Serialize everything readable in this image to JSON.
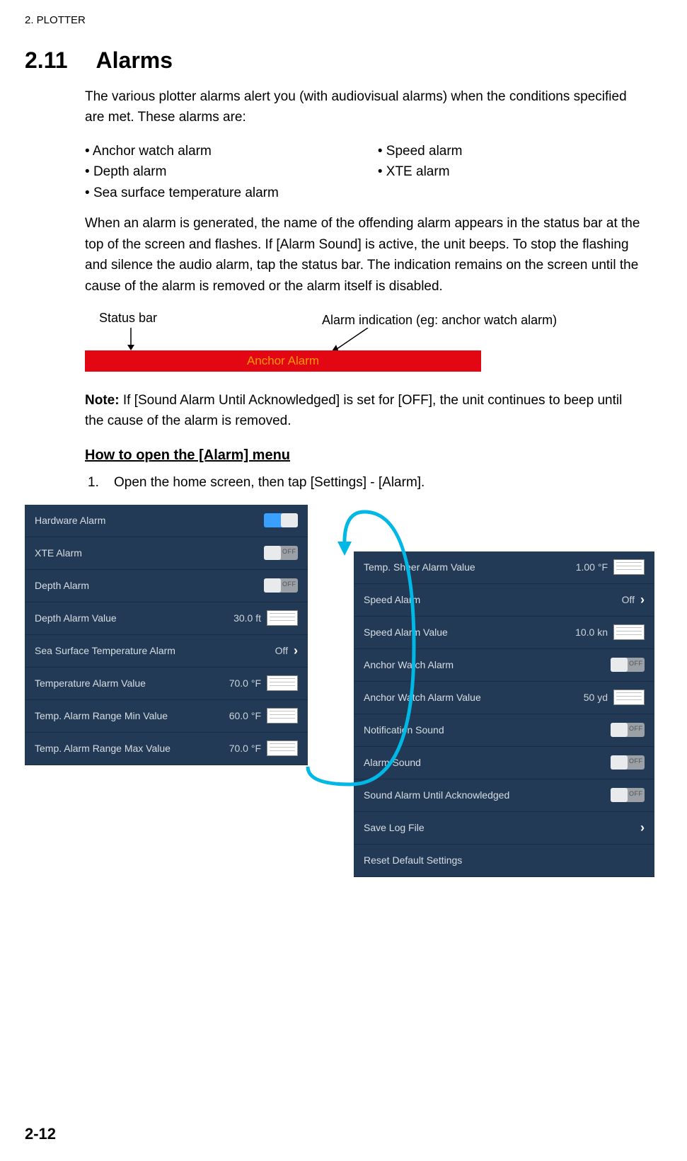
{
  "header": "2.  PLOTTER",
  "section": {
    "num": "2.11",
    "title": "Alarms"
  },
  "intro": "The various plotter alarms alert you (with audiovisual alarms) when the conditions specified are met. These alarms are:",
  "bullets_left": [
    "Anchor watch alarm",
    "Depth alarm",
    "Sea surface temperature alarm"
  ],
  "bullets_right": [
    "Speed alarm",
    "XTE alarm"
  ],
  "para2": "When an alarm is generated, the name of the offending alarm appears in the status bar at the top of the screen and flashes. If [Alarm Sound] is active, the unit beeps. To stop the flashing and silence the audio alarm, tap the status bar. The indication remains on the screen until the cause of the alarm is removed or the alarm itself is disabled.",
  "diag": {
    "status_bar_label": "Status bar",
    "alarm_indication_label": "Alarm indication (eg: anchor watch alarm)",
    "anchor_alarm_text": "Anchor Alarm"
  },
  "note_bold": "Note:",
  "note_text": " If [Sound Alarm Until Acknowledged] is set for [OFF], the unit continues to beep until the cause of the alarm is removed.",
  "subhead": "How to open the [Alarm] menu",
  "step1_num": "1.",
  "step1_text": "Open the home screen, then tap [Settings] - [Alarm].",
  "panel_a": [
    {
      "label": "Hardware Alarm",
      "type": "toggle",
      "state": "on",
      "txt": "ON"
    },
    {
      "label": "XTE Alarm",
      "type": "toggle",
      "state": "off",
      "txt": "OFF"
    },
    {
      "label": "Depth Alarm",
      "type": "toggle",
      "state": "off",
      "txt": "OFF"
    },
    {
      "label": "Depth Alarm Value",
      "type": "keypad",
      "val": "30.0 ft"
    },
    {
      "label": "Sea Surface Temperature Alarm",
      "type": "chev",
      "val": "Off"
    },
    {
      "label": "Temperature Alarm Value",
      "type": "keypad",
      "val": "70.0 °F"
    },
    {
      "label": "Temp. Alarm Range Min Value",
      "type": "keypad",
      "val": "60.0 °F"
    },
    {
      "label": "Temp. Alarm Range Max Value",
      "type": "keypad",
      "val": "70.0 °F"
    }
  ],
  "panel_b": [
    {
      "label": "Temp. Sheer Alarm Value",
      "type": "keypad",
      "val": "1.00 °F"
    },
    {
      "label": "Speed Alarm",
      "type": "chev",
      "val": "Off"
    },
    {
      "label": "Speed Alarm Value",
      "type": "keypad",
      "val": "10.0 kn"
    },
    {
      "label": "Anchor Watch Alarm",
      "type": "toggle",
      "state": "off",
      "txt": "OFF"
    },
    {
      "label": "Anchor Watch Alarm Value",
      "type": "keypad",
      "val": "50 yd"
    },
    {
      "label": "Notification Sound",
      "type": "toggle",
      "state": "off",
      "txt": "OFF"
    },
    {
      "label": "Alarm Sound",
      "type": "toggle",
      "state": "off",
      "txt": "OFF"
    },
    {
      "label": "Sound Alarm Until Acknowledged",
      "type": "toggle",
      "state": "off",
      "txt": "OFF"
    },
    {
      "label": "Save Log File",
      "type": "chev",
      "val": ""
    },
    {
      "label": "Reset Default Settings",
      "type": "plain",
      "val": ""
    }
  ],
  "page_num": "2-12"
}
